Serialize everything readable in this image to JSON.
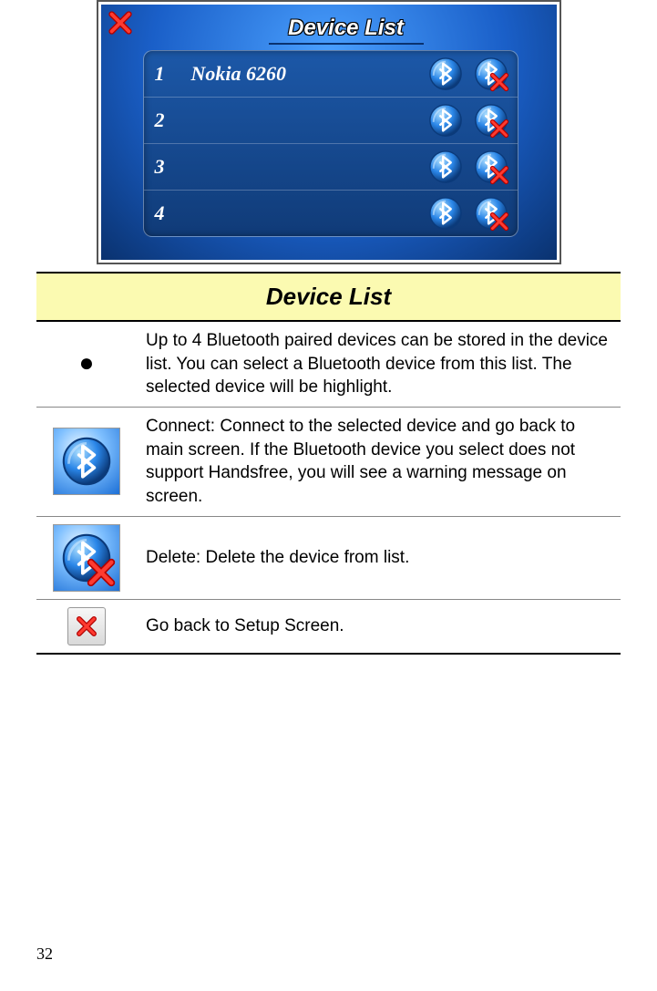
{
  "screenshot": {
    "title": "Device List",
    "rows": [
      {
        "num": "1",
        "name": "Nokia 6260"
      },
      {
        "num": "2",
        "name": ""
      },
      {
        "num": "3",
        "name": ""
      },
      {
        "num": "4",
        "name": ""
      }
    ]
  },
  "table": {
    "header": "Device List",
    "rows": {
      "intro": "Up to 4 Bluetooth paired devices can be stored in the device list. You can select a Bluetooth device from this list. The selected device will be highlight.",
      "connect": "Connect: Connect to the selected device and go back to main screen. If the Bluetooth device you select does not support Handsfree, you will see a warning message on screen.",
      "delete": "Delete: Delete the device from list.",
      "back": "Go back to Setup Screen."
    }
  },
  "page_number": "32"
}
